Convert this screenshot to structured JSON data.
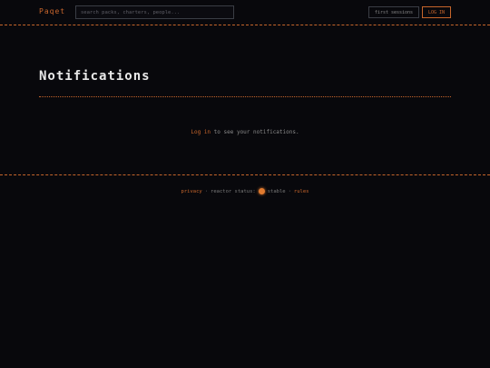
{
  "header": {
    "brand": "Paqet",
    "search_placeholder": "search packs, charters, people...",
    "sessions_label": "first sessions",
    "login_label": "LOG IN"
  },
  "main": {
    "title": "Notifications",
    "message_link": "Log in",
    "message_rest": " to see your notifications."
  },
  "footer": {
    "privacy": "privacy",
    "sep1": "·",
    "status_label": "reactor status:",
    "status_value": "stable",
    "sep2": "·",
    "rules": "rules"
  },
  "colors": {
    "accent": "#c9662c",
    "background": "#08080c",
    "status_dot": "#e07a2f"
  }
}
